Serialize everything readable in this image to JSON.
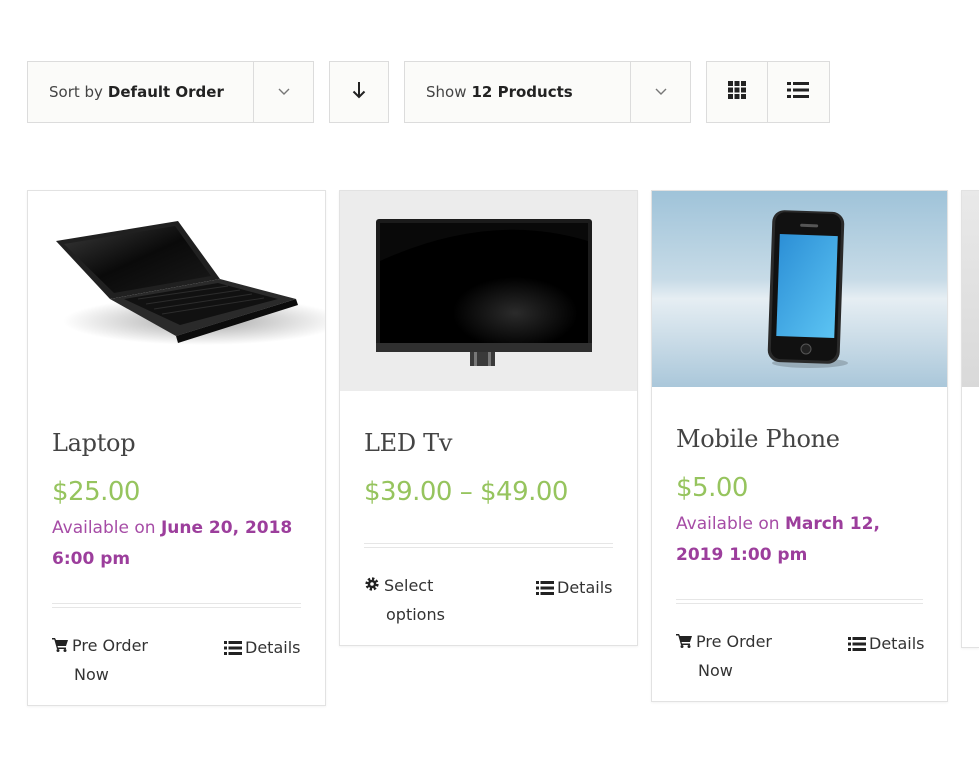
{
  "toolbar": {
    "sort_prefix": "Sort by",
    "sort_value": "Default Order",
    "show_prefix": "Show",
    "show_value": "12 Products"
  },
  "products": [
    {
      "title": "Laptop",
      "price": "$25.00",
      "avail_prefix": "Available on",
      "avail_line1": "June 20, 2018",
      "avail_line2": "6:00 pm",
      "action_line1": "Pre Order",
      "action_line2": "Now",
      "details": "Details"
    },
    {
      "title": "LED Tv",
      "price": "$39.00 – $49.00",
      "action_line1": "Select",
      "action_line2": "options",
      "details": "Details"
    },
    {
      "title": "Mobile Phone",
      "price": "$5.00",
      "avail_prefix": "Available on",
      "avail_line1": "March 12,",
      "avail_line2": "2019 1:00 pm",
      "action_line1": "Pre Order",
      "action_line2": "Now",
      "details": "Details"
    }
  ],
  "colors": {
    "price": "#96c45e",
    "availability": "#a64ca6",
    "border": "#e2e2e2"
  },
  "icons": [
    "chevron-down-icon",
    "arrow-down-icon",
    "grid-view-icon",
    "list-view-icon",
    "cart-icon",
    "gear-icon",
    "list-icon"
  ]
}
